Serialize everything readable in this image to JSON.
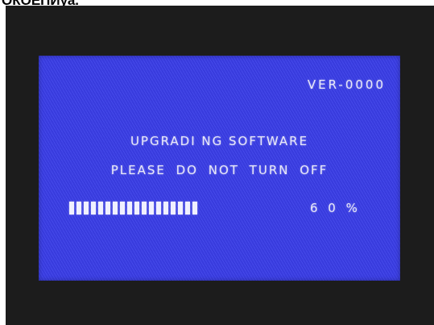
{
  "caption": "ОКОЕПИуа.",
  "screen": {
    "version": "VER-0000",
    "line1": "UPGRADI NG SOFTWARE",
    "line2": "PLEASE DO NOT TURN OFF",
    "progress_percent_label": "6 0 %",
    "progress_fraction": 0.6,
    "progress_segments_filled": 18
  },
  "colors": {
    "screen_bg": "#3b3fe8",
    "frame_bg": "#1c1c1c",
    "text": "#e8e8f8"
  }
}
